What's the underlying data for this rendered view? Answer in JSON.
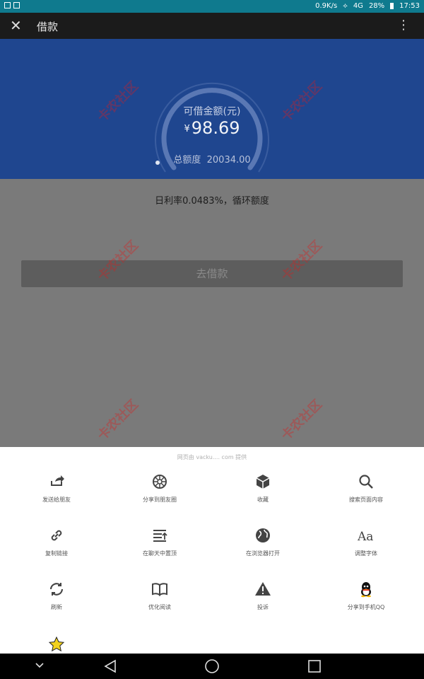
{
  "statusbar": {
    "network_speed": "0.9K/s",
    "signal_text": "4G",
    "battery_pct": "28%",
    "time": "17:53"
  },
  "topbar": {
    "title": "借款"
  },
  "hero": {
    "caption": "可借金额(元)",
    "currency": "¥",
    "amount": "98.69",
    "total_label": "总额度",
    "total_value": "20034.00",
    "accent": "#1f468f"
  },
  "content": {
    "rate_text": "日利率0.0483%，循环额度",
    "borrow_label": "去借款"
  },
  "sheet": {
    "provider_text": "网页由 vacku.... com 提供",
    "items": [
      {
        "label": "发送给朋友",
        "icon": "share-icon"
      },
      {
        "label": "分享到朋友圈",
        "icon": "moments-icon"
      },
      {
        "label": "收藏",
        "icon": "favorite-box-icon"
      },
      {
        "label": "搜索页面内容",
        "icon": "search-icon"
      },
      {
        "label": "复制链接",
        "icon": "link-icon"
      },
      {
        "label": "在聊天中置顶",
        "icon": "pin-top-icon"
      },
      {
        "label": "在浏览器打开",
        "icon": "globe-icon"
      },
      {
        "label": "调整字体",
        "icon": "font-icon"
      },
      {
        "label": "刷新",
        "icon": "refresh-icon"
      },
      {
        "label": "优化阅读",
        "icon": "book-icon"
      },
      {
        "label": "投诉",
        "icon": "warning-icon"
      },
      {
        "label": "分享到手机QQ",
        "icon": "qq-icon"
      },
      {
        "label": "",
        "icon": "star-icon"
      }
    ],
    "font_icon_text": "Aa"
  },
  "watermark": {
    "text": "卡农社区"
  }
}
